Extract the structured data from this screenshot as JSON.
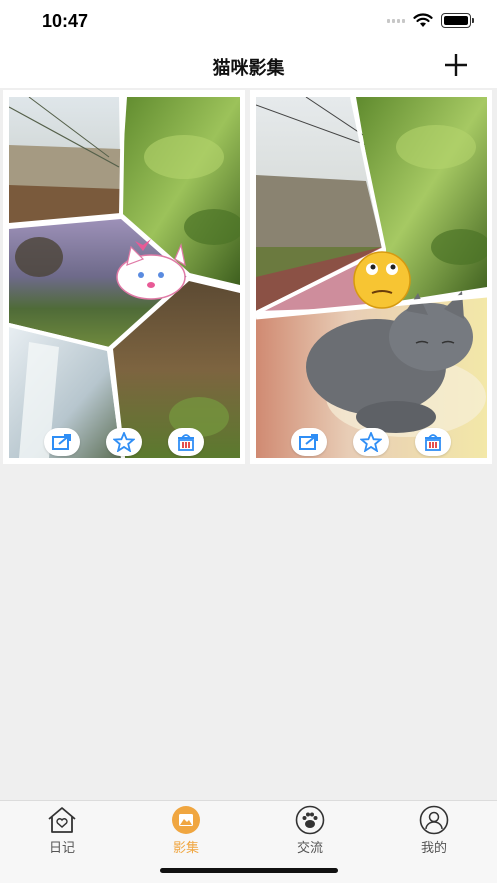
{
  "status_bar": {
    "time": "10:47"
  },
  "nav": {
    "title": "猫咪影集",
    "add_icon": "plus-icon"
  },
  "albums": [
    {
      "sticker": "cartoon-cat-sticker",
      "actions": [
        "share-icon",
        "star-icon",
        "trash-icon"
      ]
    },
    {
      "sticker": "emoji-face-sticker",
      "actions": [
        "share-icon",
        "star-icon",
        "trash-icon"
      ]
    }
  ],
  "tab_bar": {
    "items": [
      {
        "label": "日记",
        "icon": "house-heart-icon"
      },
      {
        "label": "影集",
        "icon": "album-icon"
      },
      {
        "label": "交流",
        "icon": "paw-icon"
      },
      {
        "label": "我的",
        "icon": "profile-icon"
      }
    ],
    "active_index": 1
  },
  "colors": {
    "accent": "#f0a640",
    "background": "#efefef",
    "share_icon": "#2f8ef5"
  }
}
